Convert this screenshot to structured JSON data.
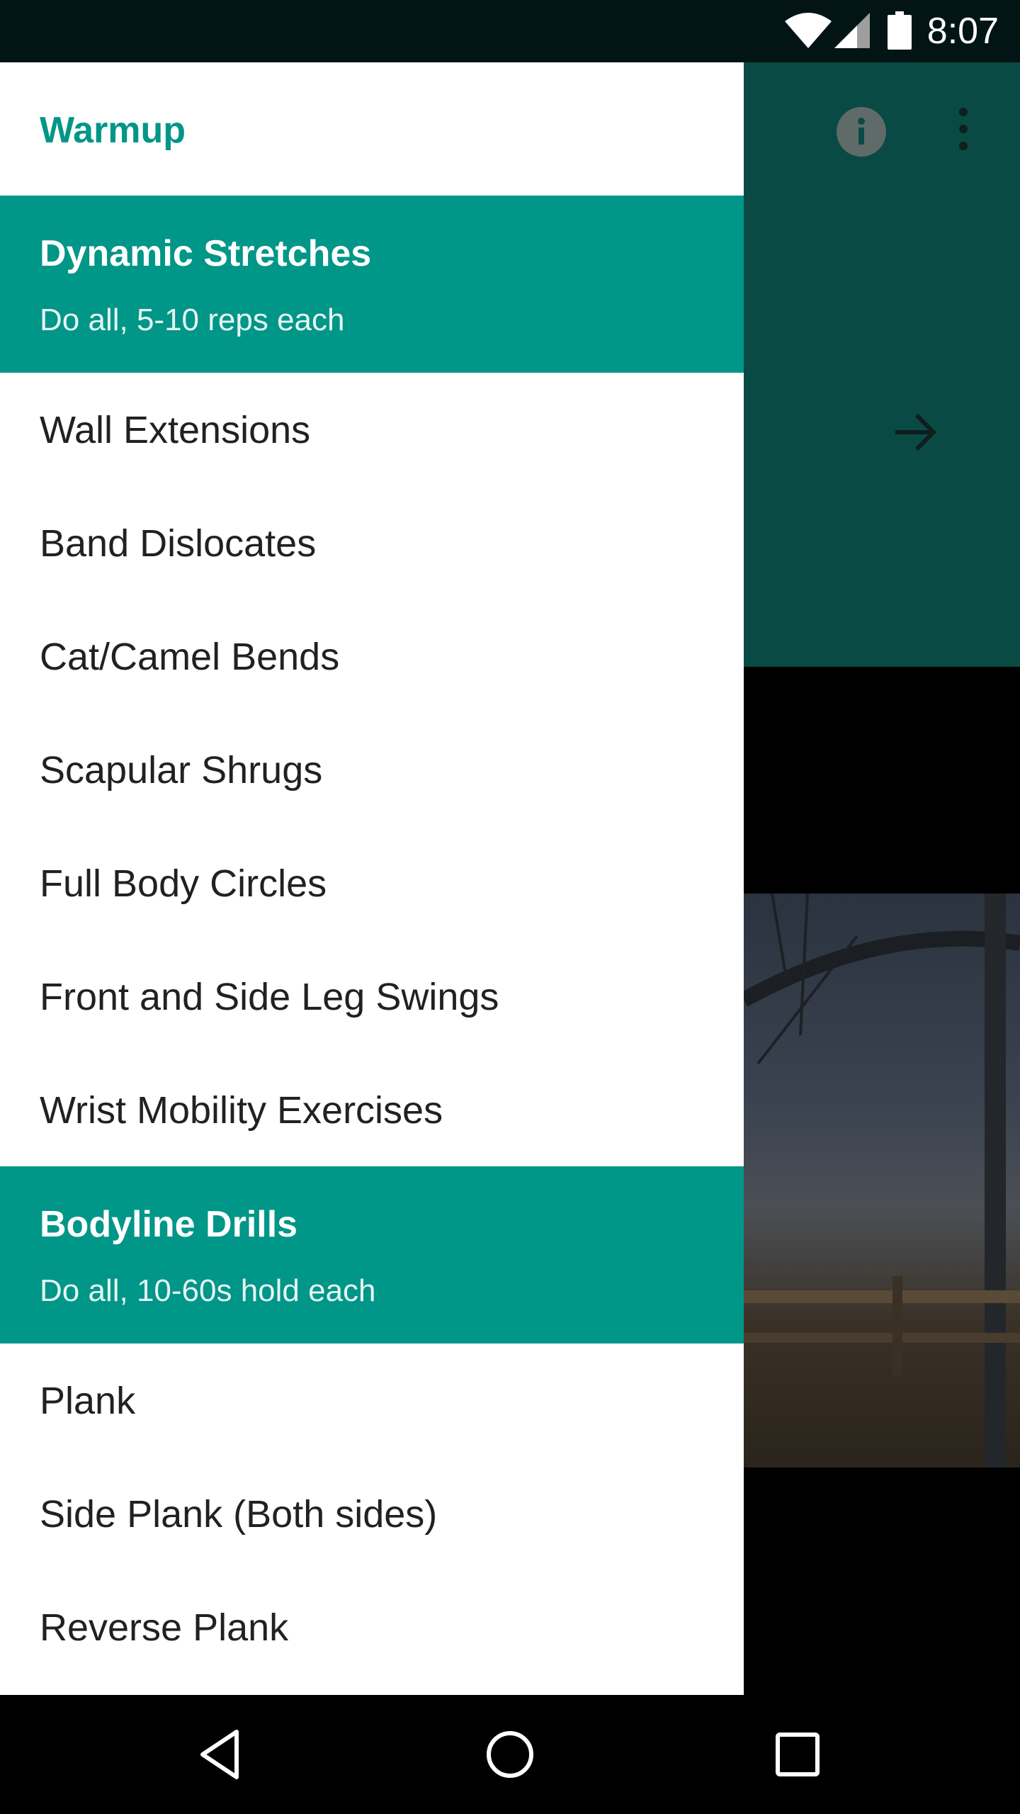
{
  "status_bar": {
    "time": "8:07",
    "icons": [
      "wifi-icon",
      "cell-signal-icon",
      "battery-icon"
    ]
  },
  "background_app": {
    "toolbar_icons": [
      "info-icon",
      "more-vert-icon"
    ],
    "content_icon": "arrow-forward-icon",
    "colors": {
      "toolbar": "#0a4a44"
    }
  },
  "drawer": {
    "title": "Warmup",
    "sections": [
      {
        "title": "Dynamic Stretches",
        "subtitle": "Do all, 5-10 reps each",
        "items": [
          "Wall Extensions",
          "Band Dislocates",
          "Cat/Camel Bends",
          "Scapular Shrugs",
          "Full Body Circles",
          "Front and Side Leg Swings",
          "Wrist Mobility Exercises"
        ]
      },
      {
        "title": "Bodyline Drills",
        "subtitle": "Do all, 10-60s hold each",
        "items": [
          "Plank",
          "Side Plank (Both sides)",
          "Reverse Plank"
        ]
      }
    ],
    "colors": {
      "accent": "#009688"
    }
  },
  "nav_bar": {
    "buttons": [
      "back-icon",
      "home-icon",
      "recent-apps-icon"
    ]
  }
}
